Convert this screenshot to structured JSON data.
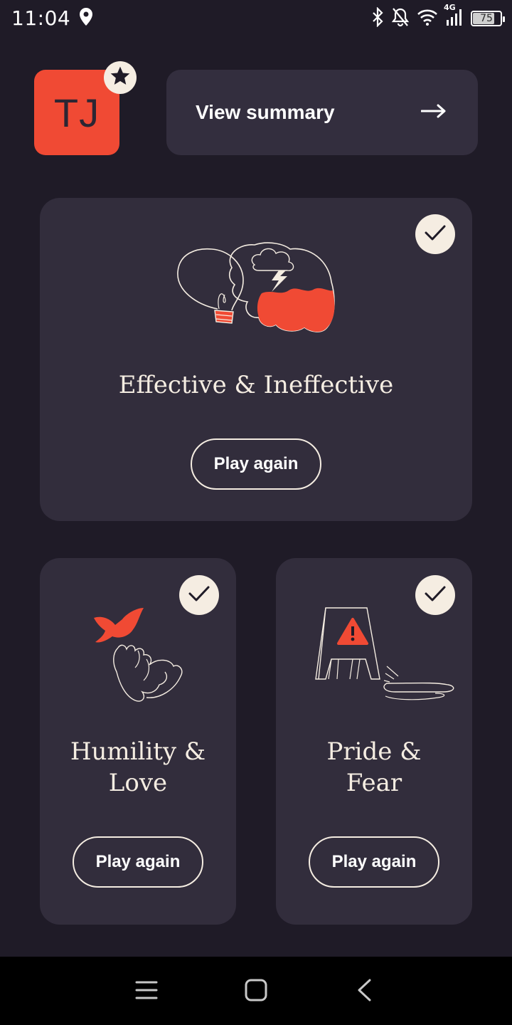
{
  "status_bar": {
    "time": "11:04",
    "battery": "75",
    "network": "4G",
    "icons": [
      "location-icon",
      "bluetooth-icon",
      "notifications-off-icon",
      "wifi-icon",
      "signal-icon",
      "battery-icon"
    ]
  },
  "header": {
    "avatar_initials": "TJ",
    "badge_icon": "star-icon",
    "summary_label": "View summary",
    "summary_icon": "arrow-right-icon"
  },
  "cards": [
    {
      "title": "Effective & Ineffective",
      "button": "Play again",
      "completed": true,
      "icon": "lightbulb-brain-illustration"
    },
    {
      "title_line1": "Humility &",
      "title_line2": "Love",
      "button": "Play again",
      "completed": true,
      "icon": "hand-bird-illustration"
    },
    {
      "title_line1": "Pride &",
      "title_line2": "Fear",
      "button": "Play again",
      "completed": true,
      "icon": "wet-floor-sign-illustration"
    }
  ],
  "nav_bar": {
    "icons": [
      "menu-icon",
      "home-icon",
      "back-icon"
    ]
  },
  "colors": {
    "background": "#1f1b27",
    "card": "#322d3c",
    "accent": "#f04a34",
    "cream": "#f5ede2",
    "nav": "#000000"
  }
}
